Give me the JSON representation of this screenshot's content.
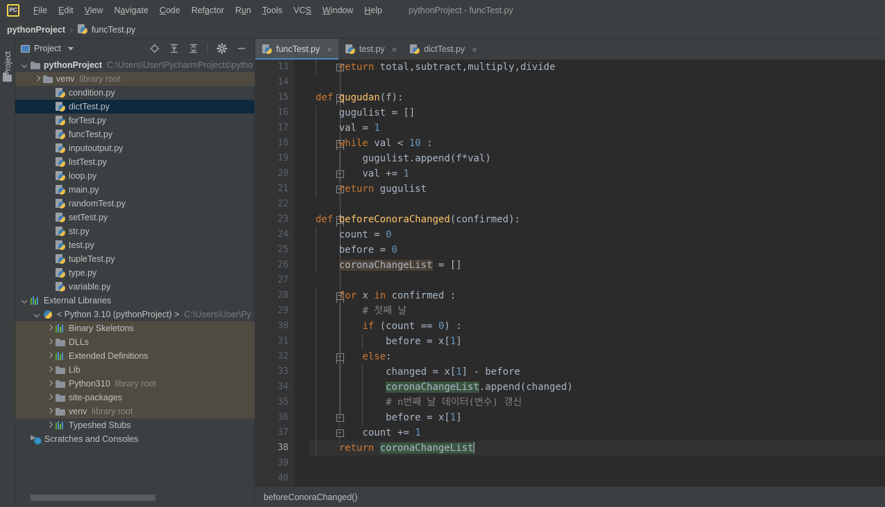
{
  "window": {
    "title": "pythonProject - funcTest.py",
    "logo_label": "PC"
  },
  "menubar": {
    "items": [
      {
        "label": "File"
      },
      {
        "label": "Edit"
      },
      {
        "label": "View"
      },
      {
        "label": "Navigate"
      },
      {
        "label": "Code"
      },
      {
        "label": "Refactor"
      },
      {
        "label": "Run"
      },
      {
        "label": "Tools"
      },
      {
        "label": "VCS"
      },
      {
        "label": "Window"
      },
      {
        "label": "Help"
      }
    ]
  },
  "breadcrumb": {
    "project": "pythonProject",
    "separator": "›",
    "file": "funcTest.py"
  },
  "left_strip": {
    "project_label": "Project"
  },
  "project_panel": {
    "title": "Project",
    "tools": [
      {
        "name": "locate-icon",
        "tooltip": "Select Opened File"
      },
      {
        "name": "expand-all-icon",
        "tooltip": "Expand All"
      },
      {
        "name": "collapse-all-icon",
        "tooltip": "Collapse All"
      },
      {
        "name": "gear-icon",
        "tooltip": "Options"
      },
      {
        "name": "minimize-icon",
        "tooltip": "Hide"
      }
    ],
    "tree": [
      {
        "label": "pythonProject",
        "suffix": "C:\\Users\\User\\PycharmProjects\\pytho",
        "suffix_type": "path",
        "icon": "folder",
        "arrow": "down",
        "depth": 0,
        "bold": true,
        "state": "normal"
      },
      {
        "label": "venv",
        "suffix": "library root",
        "suffix_type": "libroot",
        "icon": "folder",
        "arrow": "right",
        "depth": 1,
        "bold": false,
        "state": "excluded"
      },
      {
        "label": "condition.py",
        "suffix": "",
        "icon": "python",
        "arrow": "none",
        "depth": 2,
        "bold": false,
        "state": "normal"
      },
      {
        "label": "dictTest.py",
        "suffix": "",
        "icon": "python",
        "arrow": "none",
        "depth": 2,
        "bold": false,
        "state": "selected"
      },
      {
        "label": "forTest.py",
        "suffix": "",
        "icon": "python",
        "arrow": "none",
        "depth": 2,
        "bold": false,
        "state": "normal"
      },
      {
        "label": "funcTest.py",
        "suffix": "",
        "icon": "python",
        "arrow": "none",
        "depth": 2,
        "bold": false,
        "state": "normal"
      },
      {
        "label": "inputoutput.py",
        "suffix": "",
        "icon": "python",
        "arrow": "none",
        "depth": 2,
        "bold": false,
        "state": "normal"
      },
      {
        "label": "listTest.py",
        "suffix": "",
        "icon": "python",
        "arrow": "none",
        "depth": 2,
        "bold": false,
        "state": "normal"
      },
      {
        "label": "loop.py",
        "suffix": "",
        "icon": "python",
        "arrow": "none",
        "depth": 2,
        "bold": false,
        "state": "normal"
      },
      {
        "label": "main.py",
        "suffix": "",
        "icon": "python",
        "arrow": "none",
        "depth": 2,
        "bold": false,
        "state": "normal"
      },
      {
        "label": "randomTest.py",
        "suffix": "",
        "icon": "python",
        "arrow": "none",
        "depth": 2,
        "bold": false,
        "state": "normal"
      },
      {
        "label": "setTest.py",
        "suffix": "",
        "icon": "python",
        "arrow": "none",
        "depth": 2,
        "bold": false,
        "state": "normal"
      },
      {
        "label": "str.py",
        "suffix": "",
        "icon": "python",
        "arrow": "none",
        "depth": 2,
        "bold": false,
        "state": "normal"
      },
      {
        "label": "test.py",
        "suffix": "",
        "icon": "python",
        "arrow": "none",
        "depth": 2,
        "bold": false,
        "state": "normal"
      },
      {
        "label": "tupleTest.py",
        "suffix": "",
        "icon": "python",
        "arrow": "none",
        "depth": 2,
        "bold": false,
        "state": "normal"
      },
      {
        "label": "type.py",
        "suffix": "",
        "icon": "python",
        "arrow": "none",
        "depth": 2,
        "bold": false,
        "state": "normal"
      },
      {
        "label": "variable.py",
        "suffix": "",
        "icon": "python",
        "arrow": "none",
        "depth": 2,
        "bold": false,
        "state": "normal"
      },
      {
        "label": "External Libraries",
        "suffix": "",
        "icon": "library",
        "arrow": "down",
        "depth": 0,
        "bold": false,
        "state": "normal"
      },
      {
        "label": "< Python 3.10 (pythonProject) >",
        "suffix": "C:\\Users\\User\\Py",
        "suffix_type": "path",
        "icon": "snake",
        "arrow": "down",
        "depth": 1,
        "bold": false,
        "state": "normal"
      },
      {
        "label": "Binary Skeletons",
        "suffix": "",
        "icon": "library",
        "arrow": "right",
        "depth": 2,
        "bold": false,
        "state": "excluded"
      },
      {
        "label": "DLLs",
        "suffix": "",
        "icon": "folder",
        "arrow": "right",
        "depth": 2,
        "bold": false,
        "state": "excluded"
      },
      {
        "label": "Extended Definitions",
        "suffix": "",
        "icon": "library",
        "arrow": "right",
        "depth": 2,
        "bold": false,
        "state": "excluded"
      },
      {
        "label": "Lib",
        "suffix": "",
        "icon": "folder",
        "arrow": "right",
        "depth": 2,
        "bold": false,
        "state": "excluded"
      },
      {
        "label": "Python310",
        "suffix": "library root",
        "suffix_type": "libroot",
        "icon": "folder",
        "arrow": "right",
        "depth": 2,
        "bold": false,
        "state": "excluded"
      },
      {
        "label": "site-packages",
        "suffix": "",
        "icon": "folder",
        "arrow": "right",
        "depth": 2,
        "bold": false,
        "state": "excluded"
      },
      {
        "label": "venv",
        "suffix": "library root",
        "suffix_type": "libroot",
        "icon": "folder",
        "arrow": "right",
        "depth": 2,
        "bold": false,
        "state": "excluded"
      },
      {
        "label": "Typeshed Stubs",
        "suffix": "",
        "icon": "library",
        "arrow": "right",
        "depth": 2,
        "bold": false,
        "state": "normal"
      },
      {
        "label": "Scratches and Consoles",
        "suffix": "",
        "icon": "scratch",
        "arrow": "none",
        "depth": 0,
        "bold": false,
        "state": "normal"
      }
    ]
  },
  "editor": {
    "tabs": [
      {
        "label": "funcTest.py",
        "active": true,
        "close": "×"
      },
      {
        "label": "test.py",
        "active": false,
        "close": "×"
      },
      {
        "label": "dictTest.py",
        "active": false,
        "close": "×"
      }
    ],
    "first_line_number": 13,
    "caret_line": 38,
    "lines": [
      {
        "n": 13,
        "indent": 1,
        "text": "return total,subtract,multiply,divide"
      },
      {
        "n": 14,
        "indent": 0,
        "text": ""
      },
      {
        "n": 15,
        "indent": 0,
        "text": "def gugudan(f):"
      },
      {
        "n": 16,
        "indent": 1,
        "text": "gugulist = []"
      },
      {
        "n": 17,
        "indent": 1,
        "text": "val = 1"
      },
      {
        "n": 18,
        "indent": 1,
        "text": "while val < 10 :"
      },
      {
        "n": 19,
        "indent": 2,
        "text": "gugulist.append(f*val)"
      },
      {
        "n": 20,
        "indent": 2,
        "text": "val += 1"
      },
      {
        "n": 21,
        "indent": 1,
        "text": "return gugulist"
      },
      {
        "n": 22,
        "indent": 0,
        "text": ""
      },
      {
        "n": 23,
        "indent": 0,
        "text": "def beforeConoraChanged(confirmed):"
      },
      {
        "n": 24,
        "indent": 1,
        "text": "count = 0"
      },
      {
        "n": 25,
        "indent": 1,
        "text": "before = 0"
      },
      {
        "n": 26,
        "indent": 1,
        "text": "coronaChangeList = []"
      },
      {
        "n": 27,
        "indent": 0,
        "text": ""
      },
      {
        "n": 28,
        "indent": 1,
        "text": "for x in confirmed :"
      },
      {
        "n": 29,
        "indent": 2,
        "text": "# 첫째 날"
      },
      {
        "n": 30,
        "indent": 2,
        "text": "if (count == 0) :"
      },
      {
        "n": 31,
        "indent": 3,
        "text": "before = x[1]"
      },
      {
        "n": 32,
        "indent": 2,
        "text": "else:"
      },
      {
        "n": 33,
        "indent": 3,
        "text": "changed = x[1] - before"
      },
      {
        "n": 34,
        "indent": 3,
        "text": "coronaChangeList.append(changed)"
      },
      {
        "n": 35,
        "indent": 3,
        "text": "# n번째 날 데이터(변수) 갱신"
      },
      {
        "n": 36,
        "indent": 3,
        "text": "before = x[1]"
      },
      {
        "n": 37,
        "indent": 2,
        "text": "count += 1"
      },
      {
        "n": 38,
        "indent": 1,
        "text": "return coronaChangeList"
      },
      {
        "n": 39,
        "indent": 0,
        "text": ""
      },
      {
        "n": 40,
        "indent": 0,
        "text": ""
      }
    ]
  },
  "status_bar": {
    "text": "beforeConoraChanged()"
  },
  "colors": {
    "keyword": "#cc7832",
    "function": "#ffc66d",
    "number": "#6897bb",
    "comment": "#808080",
    "identifier": "#a9b7c6",
    "editor_bg": "#2b2b2b",
    "panel_bg": "#3c3f41",
    "selection": "#0d293e",
    "excluded": "#4f4b41",
    "tab_accent": "#4a88c7",
    "usage_highlight": "#3a5540",
    "caret_highlight": "#4a3f35"
  }
}
